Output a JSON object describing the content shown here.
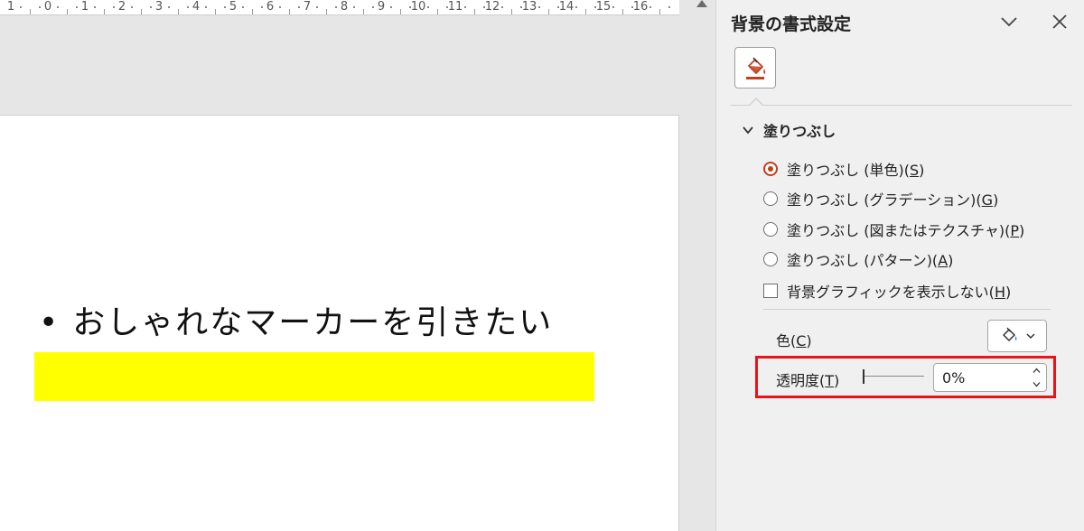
{
  "ruler": {
    "labels": [
      "1",
      "0",
      "1",
      "2",
      "3",
      "4",
      "5",
      "6",
      "7",
      "8",
      "9",
      "10",
      "11",
      "12",
      "13",
      "14",
      "15",
      "16"
    ]
  },
  "slide": {
    "bullet_glyph": "•",
    "bullet_text": "おしゃれなマーカーを引きたい",
    "marker_color": "#ffff00"
  },
  "pane": {
    "title": "背景の書式設定",
    "collapse_icon": "chevron-down-icon",
    "close_icon": "close-icon",
    "fill_tab_icon": "paint-bucket-icon",
    "section": {
      "label": "塗りつぶし",
      "expanded": true
    },
    "fill_options": [
      {
        "label": "塗りつぶし (単色)(",
        "key": "S",
        "suffix": ")",
        "selected": true
      },
      {
        "label": "塗りつぶし (グラデーション)(",
        "key": "G",
        "suffix": ")",
        "selected": false
      },
      {
        "label": "塗りつぶし (図またはテクスチャ)(",
        "key": "P",
        "suffix": ")",
        "selected": false
      },
      {
        "label": "塗りつぶし (パターン)(",
        "key": "A",
        "suffix": ")",
        "selected": false
      }
    ],
    "hide_graphics": {
      "label": "背景グラフィックを表示しない(",
      "key": "H",
      "suffix": ")",
      "checked": false
    },
    "color": {
      "label": "色(",
      "key": "C",
      "suffix": ")",
      "icon": "paint-bucket-icon"
    },
    "transparency": {
      "label": "透明度(",
      "key": "T",
      "suffix": ")",
      "value": "0%",
      "fraction": 0
    },
    "accent": "#c43e1c",
    "highlight_color": "#e8141b"
  }
}
